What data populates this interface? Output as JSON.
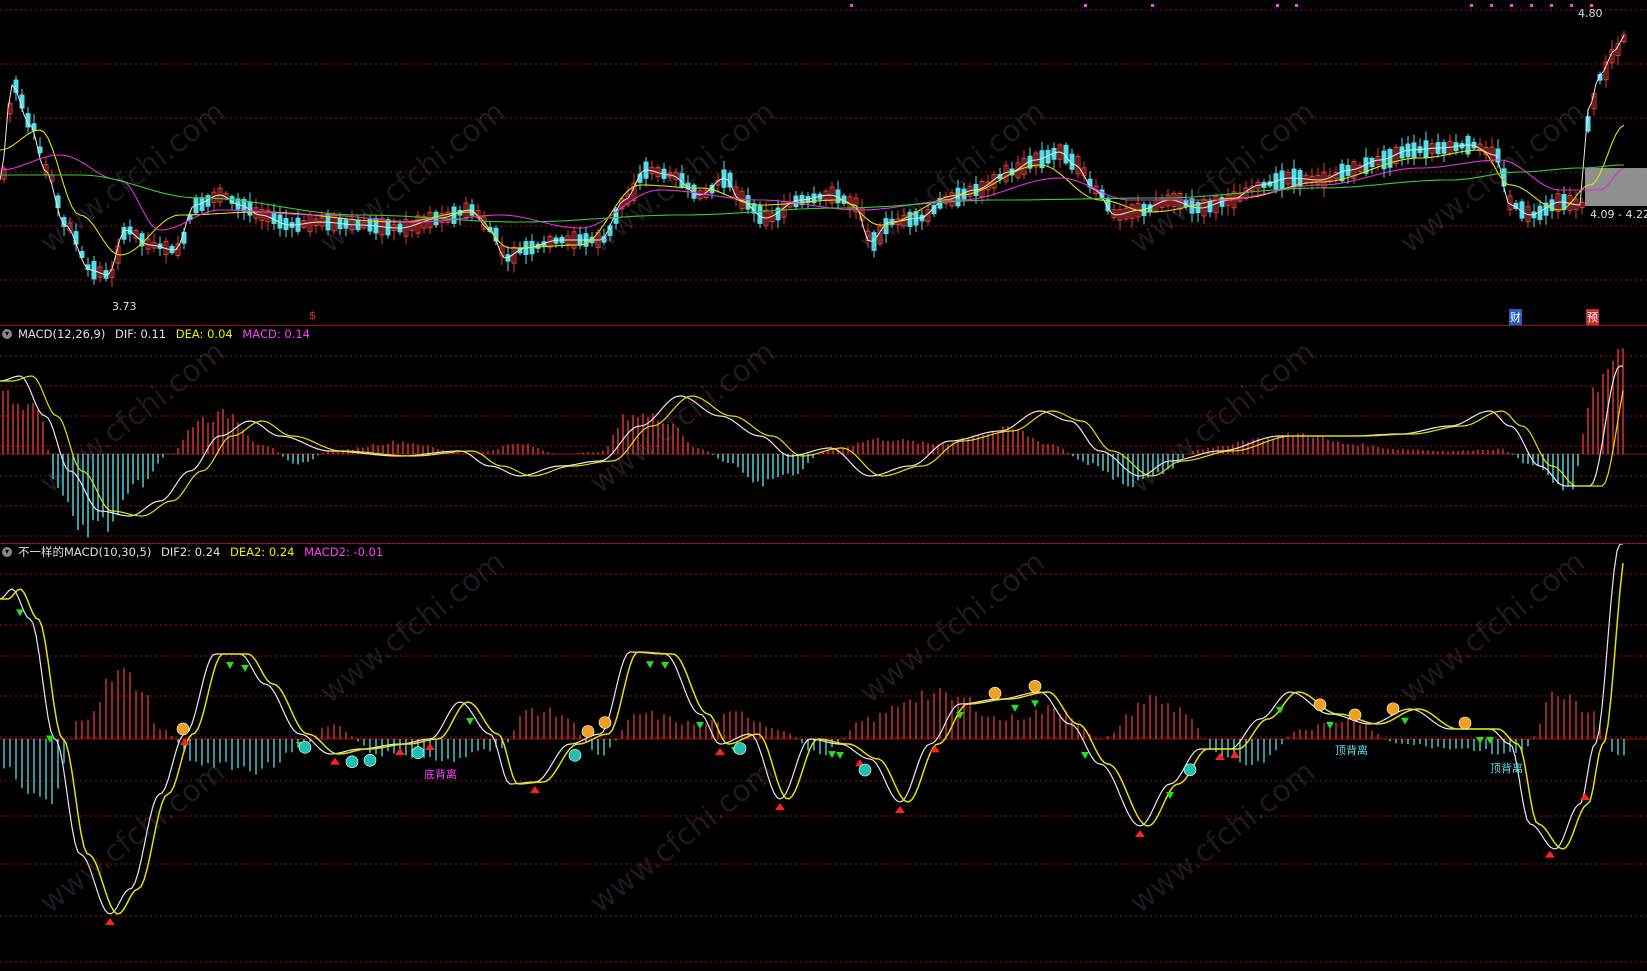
{
  "colors": {
    "up": "#e33a3a",
    "down": "#54e0e8",
    "ma5": "#e8e8e8",
    "ma10": "#e6e000",
    "ma20": "#e030e0",
    "ma60": "#30d030",
    "grid": "#9a1010",
    "dif": "#e8e8e8",
    "dea": "#e6e000",
    "macd": "#ff40ff"
  },
  "price_panel": {
    "min_label": "3.73",
    "max_label": "4.80",
    "range_label": "4.09 - 4.22",
    "markers": [
      {
        "text": "$"
      },
      {
        "text": "财"
      },
      {
        "text": "预"
      }
    ]
  },
  "macd_panel": {
    "name": "MACD(12,26,9)",
    "dif_label": "DIF:",
    "dif_value": "0.11",
    "dea_label": "DEA:",
    "dea_value": "0.04",
    "macd_label": "MACD:",
    "macd_value": "0.14"
  },
  "macd2_panel": {
    "name": "不一样的MACD(10,30,5)",
    "dif_label": "DIF2:",
    "dif_value": "0.24",
    "dea_label": "DEA2:",
    "dea_value": "0.24",
    "macd_label": "MACD2:",
    "macd_value": "-0.01",
    "annotations": [
      "底背离",
      "顶背离",
      "顶背离"
    ]
  },
  "watermark": "www.cfchi.com",
  "chart_data": [
    {
      "type": "candlestick",
      "title": "",
      "ylim": [
        3.73,
        4.8
      ],
      "notes": "daily candles with MA5/MA10/MA20/MA60 overlays; min 3.73, max 4.80"
    },
    {
      "type": "line+bar",
      "title": "MACD(12,26,9)",
      "series": [
        {
          "name": "DIF",
          "last": 0.11
        },
        {
          "name": "DEA",
          "last": 0.04
        },
        {
          "name": "MACD",
          "last": 0.14
        }
      ]
    },
    {
      "type": "line+bar",
      "title": "不一样的MACD(10,30,5)",
      "series": [
        {
          "name": "DIF2",
          "last": 0.24
        },
        {
          "name": "DEA2",
          "last": 0.24
        },
        {
          "name": "MACD2",
          "last": -0.01
        }
      ]
    }
  ]
}
